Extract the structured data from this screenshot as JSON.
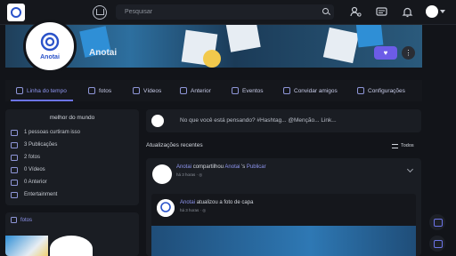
{
  "topbar": {
    "search_placeholder": "Pesquisar",
    "icons": [
      "home-icon",
      "search-icon",
      "user-settings-icon",
      "messages-icon",
      "notifications-icon",
      "avatar",
      "chevron-down-icon"
    ]
  },
  "profile": {
    "name": "Anotai",
    "logo_label": "Anotai",
    "heart_label": "♥",
    "more_label": "⋮"
  },
  "tabs": [
    {
      "label": "Linha do tempo",
      "icon": "timeline-icon",
      "active": true
    },
    {
      "label": "fotos",
      "icon": "photo-icon"
    },
    {
      "label": "Vídeos",
      "icon": "video-icon"
    },
    {
      "label": "Anterior",
      "icon": "star-icon"
    },
    {
      "label": "Eventos",
      "icon": "calendar-icon"
    },
    {
      "label": "Convidar amigos",
      "icon": "invite-icon"
    },
    {
      "label": "Configurações",
      "icon": "settings-icon"
    }
  ],
  "about": {
    "title": "melhor do mundo",
    "rows": [
      {
        "icon": "likes-icon",
        "text": "1 pessoas curtiram isso"
      },
      {
        "icon": "posts-icon",
        "text": "3 Publicações"
      },
      {
        "icon": "photo-icon",
        "text": "2 fotos"
      },
      {
        "icon": "video-icon",
        "text": "0 Vídeos"
      },
      {
        "icon": "star-icon",
        "text": "0 Anterior"
      },
      {
        "icon": "tag-icon",
        "text": "Entertainment"
      }
    ]
  },
  "fotos_card": {
    "title": "fotos"
  },
  "composer": {
    "placeholder": "No que você está pensando? #Hashtag... @Menção... Link..."
  },
  "updates": {
    "label": "Atualizações recentes",
    "filter": "Todos"
  },
  "post": {
    "author": "Anotai",
    "action": "compartilhou",
    "target": "Anotai",
    "target_suffix": "'s",
    "object": "Publicar",
    "meta": "há 3 horas · ◎"
  },
  "inner_post": {
    "author": "Anotai",
    "action": "atualizou a foto de capa",
    "meta": "há 3 horas · ◎"
  },
  "colors": {
    "accent": "#6c74e8",
    "bg": "#121419",
    "card": "#1a1d23"
  }
}
